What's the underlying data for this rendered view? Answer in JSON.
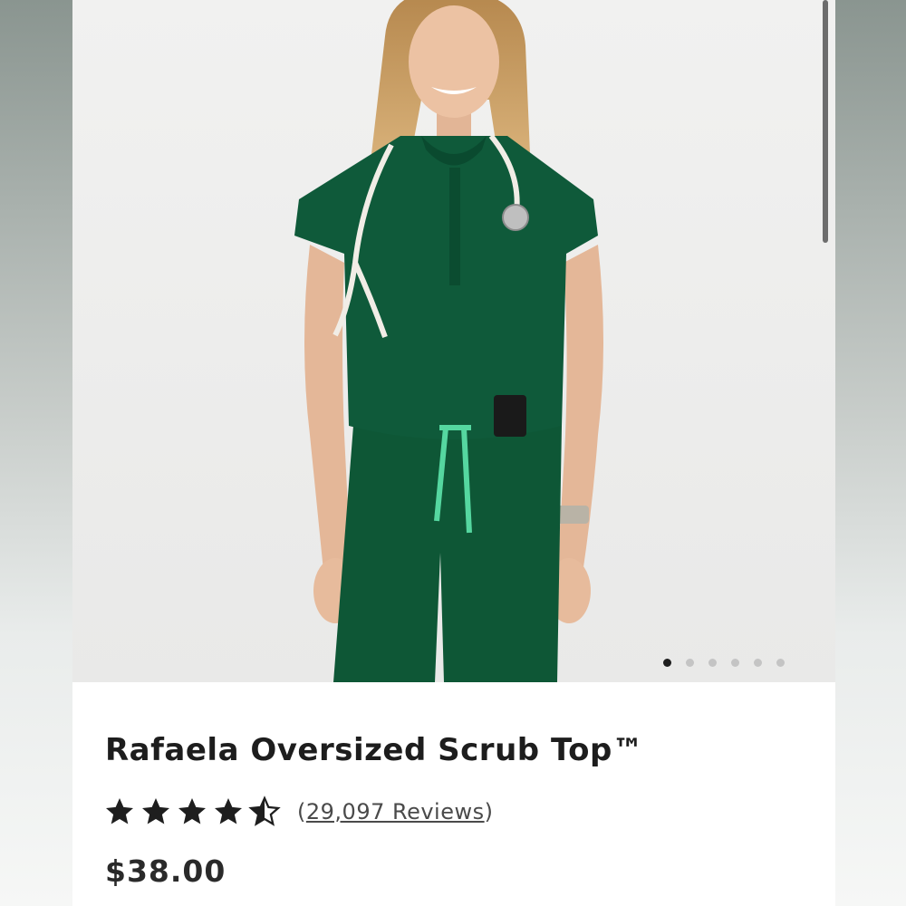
{
  "carousel": {
    "slide_count": 6,
    "active_index": 0
  },
  "product": {
    "title": "Rafaela Oversized Scrub Top™",
    "rating": 4.5,
    "rating_max": 5,
    "reviews_open": "(",
    "reviews_link": "29,097 Reviews",
    "reviews_close": ")",
    "price": "$38.00"
  },
  "colors": {
    "scrub_green": "#0f5a3a",
    "drawstring": "#55d7a0",
    "text_dark": "#1d1d1d",
    "star": "#1e1e1e"
  },
  "icons": {
    "star": "star-icon",
    "half_star": "half-star-icon"
  }
}
